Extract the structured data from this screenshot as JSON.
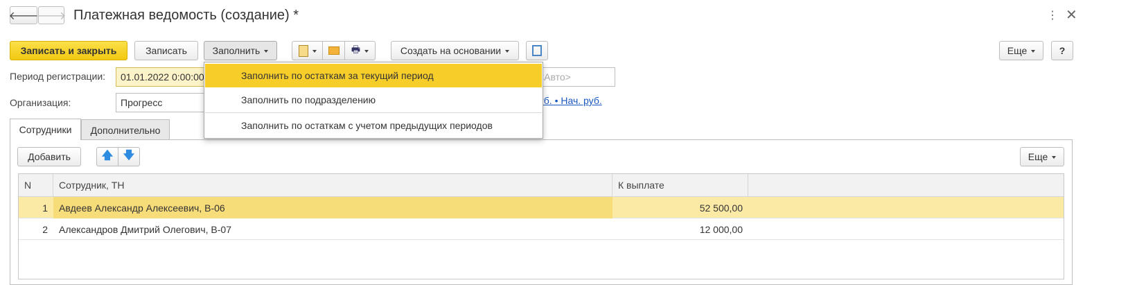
{
  "window": {
    "title": "Платежная ведомость (создание) *"
  },
  "toolbar": {
    "save_close": "Записать и закрыть",
    "save": "Записать",
    "fill": "Заполнить",
    "create_basis": "Создать на основании",
    "more": "Еще",
    "help": "?"
  },
  "fields": {
    "period_label": "Период регистрации:",
    "period_value": "01.01.2022 0:00:00",
    "number_placeholder": "<Авто>",
    "org_label": "Организация:",
    "org_value": "Прогресс",
    "currency_link": "руб. • Нач. руб."
  },
  "fill_menu": {
    "items": [
      "Заполнить по остаткам за текущий период",
      "Заполнить по подразделению",
      "Заполнить по остаткам с учетом предыдущих периодов"
    ],
    "selected_index": 0
  },
  "tabs": [
    "Сотрудники",
    "Дополнительно"
  ],
  "table_toolbar": {
    "add": "Добавить",
    "more": "Еще"
  },
  "table": {
    "columns": [
      "N",
      "Сотрудник, ТН",
      "К выплате"
    ],
    "rows": [
      {
        "n": "1",
        "employee": "Авдеев Александр Алексеевич, В-06",
        "amount": "52 500,00"
      },
      {
        "n": "2",
        "employee": "Александров Дмитрий Олегович, В-07",
        "amount": "12 000,00"
      }
    ]
  },
  "colors": {
    "primary": "#f5d32b",
    "selected_row": "#fbe9a6",
    "menu_highlight": "#f7cd2a",
    "link": "#1a56c2",
    "arrow_blue": "#2d8ce0"
  }
}
